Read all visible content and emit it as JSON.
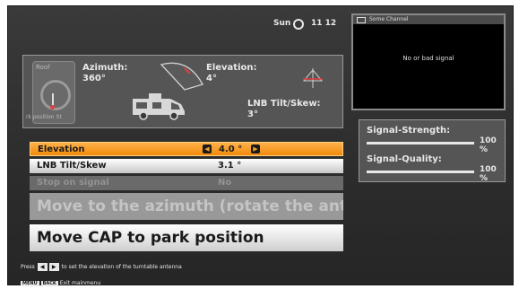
{
  "status": {
    "day": "Sun",
    "time": "11 12"
  },
  "preview": {
    "channel": "Some Channel",
    "message": "No or bad signal"
  },
  "antenna": {
    "roof_label": "Roof",
    "park_label": "rk position St",
    "azimuth_label": "Azimuth:",
    "azimuth_value": "360°",
    "elevation_label": "Elevation:",
    "elevation_value": "4°",
    "lnb_label": "LNB Tilt/Skew:",
    "lnb_value": "3°"
  },
  "menu": {
    "elevation": {
      "label": "Elevation",
      "value": "4.0 °"
    },
    "lnb": {
      "label": "LNB Tilt/Skew",
      "value": "3.1 °"
    },
    "stop": {
      "label": "Stop on signal",
      "value": "No"
    },
    "move_azimuth": "Move to the azimuth (rotate the anten.",
    "move_park": "Move CAP to park position"
  },
  "signal": {
    "strength_label": "Signal-Strength:",
    "strength_value": "100 %",
    "strength_level": 1.0,
    "quality_label": "Signal-Quality:",
    "quality_value": "100 %",
    "quality_level": 1.0
  },
  "hint": {
    "press": "Press",
    "rest": "to set the elevation of the turntable antenna"
  },
  "footer": {
    "menu_key": "MENU",
    "back_key": "BACK",
    "label": "Exit mainmenu"
  },
  "colors": {
    "accent": "#f08a0c",
    "indicator": "#e04040"
  },
  "icons": [
    "clock-icon",
    "tv-icon",
    "dial-icon",
    "dish-icon",
    "camper-icon",
    "cap-symbol-icon",
    "arrow-left-icon",
    "arrow-right-icon"
  ]
}
